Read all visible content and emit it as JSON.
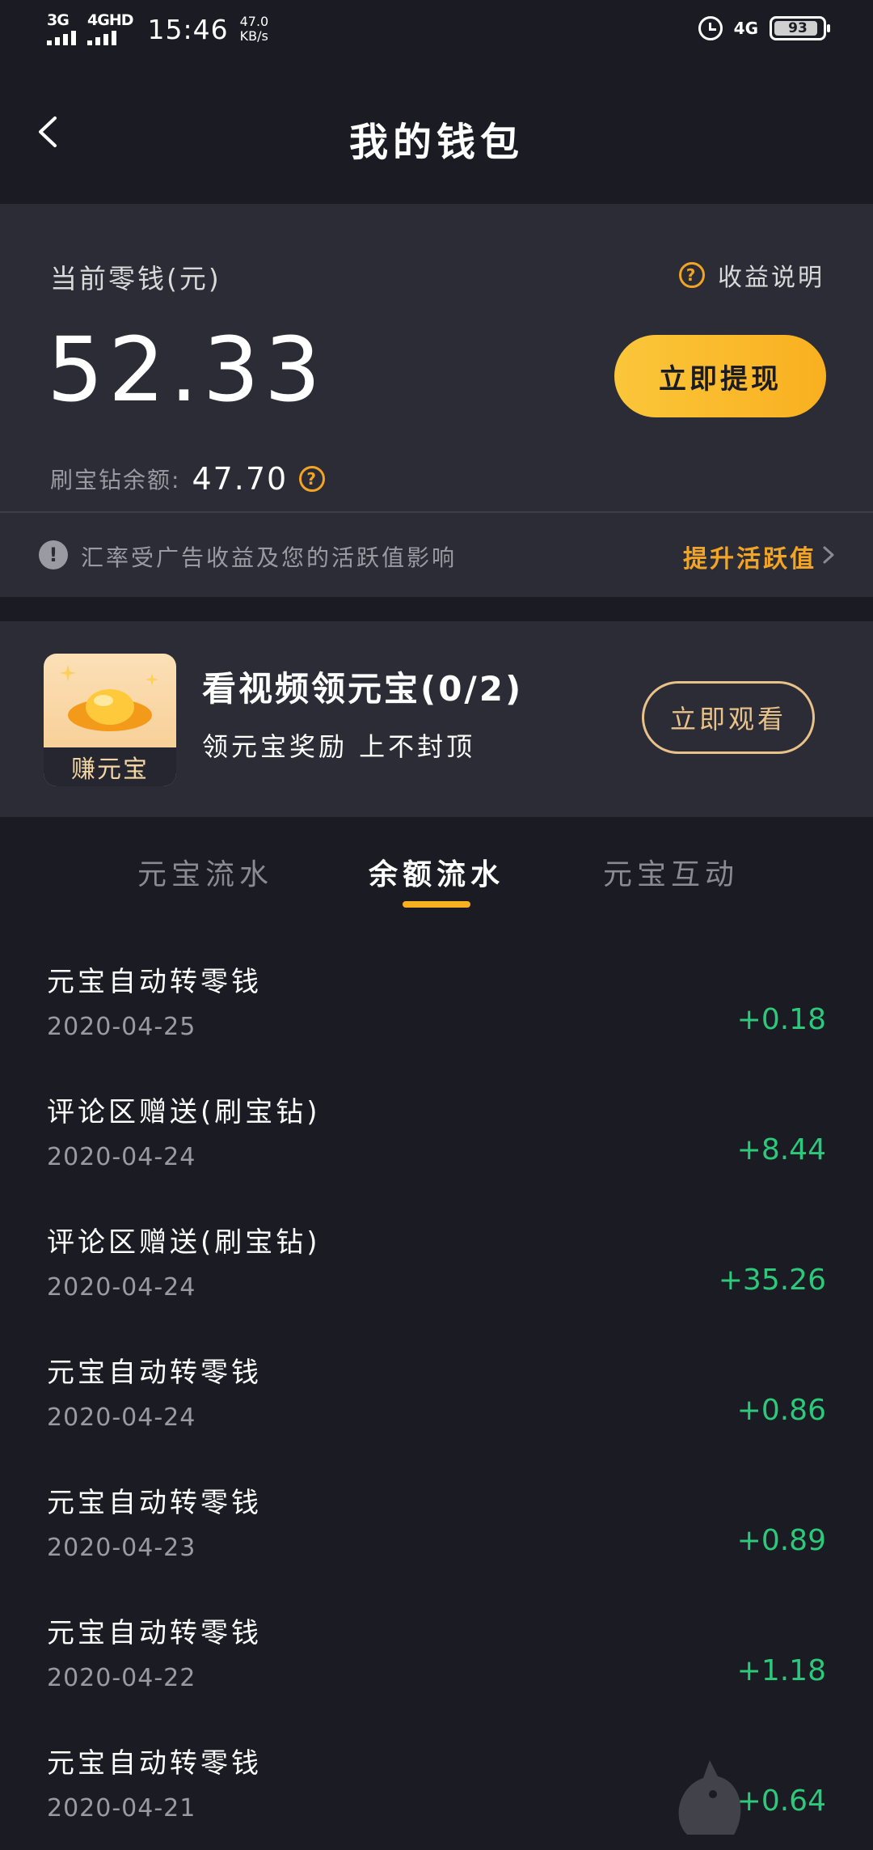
{
  "status_bar": {
    "signal1": "3G",
    "signal2": "4GHD",
    "time": "15:46",
    "speed_value": "47.0",
    "speed_unit": "KB/s",
    "network": "4G",
    "battery": "93"
  },
  "header": {
    "title": "我的钱包"
  },
  "balance": {
    "label": "当前零钱(元)",
    "explain_label": "收益说明",
    "amount": "52.33",
    "withdraw_label": "立即提现",
    "diamond_label": "刷宝钻余额:",
    "diamond_value": "47.70"
  },
  "notice": {
    "text": "汇率受广告收益及您的活跃值影响",
    "link_label": "提升活跃值"
  },
  "promo": {
    "image_label": "赚元宝",
    "title": "看视频领元宝(0/2)",
    "subtitle": "领元宝奖励 上不封顶",
    "button_label": "立即观看"
  },
  "tabs": [
    {
      "label": "元宝流水"
    },
    {
      "label": "余额流水"
    },
    {
      "label": "元宝互动"
    }
  ],
  "transactions": [
    {
      "title": "元宝自动转零钱",
      "date": "2020-04-25",
      "amount": "+0.18"
    },
    {
      "title": "评论区赠送(刷宝钻)",
      "date": "2020-04-24",
      "amount": "+8.44"
    },
    {
      "title": "评论区赠送(刷宝钻)",
      "date": "2020-04-24",
      "amount": "+35.26"
    },
    {
      "title": "元宝自动转零钱",
      "date": "2020-04-24",
      "amount": "+0.86"
    },
    {
      "title": "元宝自动转零钱",
      "date": "2020-04-23",
      "amount": "+0.89"
    },
    {
      "title": "元宝自动转零钱",
      "date": "2020-04-22",
      "amount": "+1.18"
    },
    {
      "title": "元宝自动转零钱",
      "date": "2020-04-21",
      "amount": "+0.64"
    }
  ],
  "colors": {
    "background": "#1a1b23",
    "card": "#2b2c36",
    "accent": "#f9b020",
    "positive": "#2cc97a"
  }
}
